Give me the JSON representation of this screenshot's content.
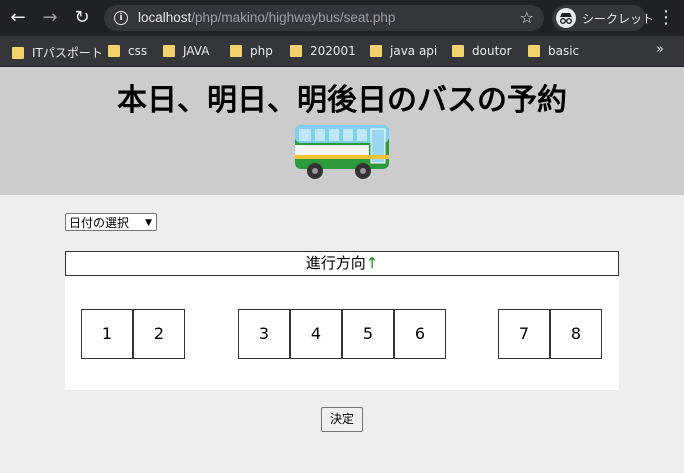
{
  "browser": {
    "url_host": "localhost",
    "url_path": "/php/makino/highwaybus/seat.php",
    "incognito_label": "シークレット",
    "bookmarks": [
      "ITパスポート",
      "css",
      "JAVA",
      "php",
      "202001",
      "java api",
      "doutor",
      "basic"
    ]
  },
  "page": {
    "title": "本日、明日、明後日のバスの予約",
    "date_select": "日付の選択",
    "direction_label": "進行方向",
    "direction_arrow": "↑",
    "seats": [
      "1",
      "2",
      "3",
      "4",
      "5",
      "6",
      "7",
      "8"
    ],
    "decide_button": "決定"
  }
}
